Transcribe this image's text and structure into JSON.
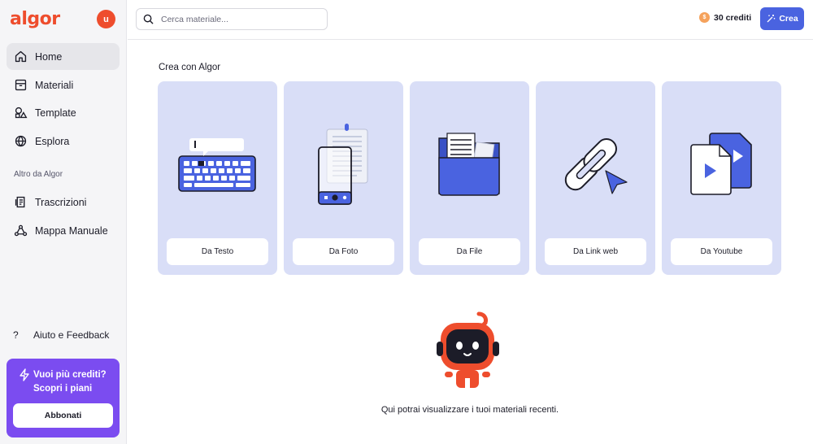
{
  "app": {
    "logo": "algor",
    "avatar_initial": "u"
  },
  "sidebar": {
    "items": [
      {
        "label": "Home",
        "icon": "home-icon",
        "active": true
      },
      {
        "label": "Materiali",
        "icon": "archive-icon"
      },
      {
        "label": "Template",
        "icon": "shapes-icon"
      },
      {
        "label": "Esplora",
        "icon": "globe-icon"
      }
    ],
    "section_label": "Altro da Algor",
    "more_items": [
      {
        "label": "Trascrizioni",
        "icon": "transcript-icon"
      },
      {
        "label": "Mappa Manuale",
        "icon": "mindmap-icon"
      }
    ],
    "help_label": "Aiuto e Feedback",
    "promo": {
      "title_line1": "Vuoi più crediti?",
      "title_line2": "Scopri i piani",
      "button_label": "Abbonati"
    }
  },
  "header": {
    "search_placeholder": "Cerca materiale...",
    "credits": "30 crediti",
    "create_label": "Crea"
  },
  "main": {
    "section_title": "Crea con Algor",
    "cards": [
      {
        "label": "Da Testo",
        "icon": "keyboard-icon"
      },
      {
        "label": "Da Foto",
        "icon": "phone-photo-icon"
      },
      {
        "label": "Da File",
        "icon": "folder-icon"
      },
      {
        "label": "Da Link web",
        "icon": "link-icon"
      },
      {
        "label": "Da Youtube",
        "icon": "video-file-icon"
      }
    ],
    "empty_state": "Qui potrai visualizzare i tuoi materiali recenti."
  },
  "colors": {
    "brand": "#ee4d2d",
    "accent": "#4a63e0",
    "promo": "#7b4cf0",
    "card_bg": "#d9def7"
  }
}
